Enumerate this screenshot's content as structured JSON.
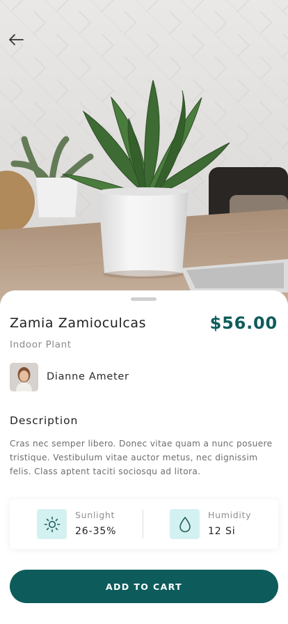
{
  "product": {
    "name": "Zamia Zamioculcas",
    "category": "Indoor Plant",
    "price": "$56.00"
  },
  "owner": {
    "name": "Dianne Ameter"
  },
  "description": {
    "heading": "Description",
    "text": "Cras nec semper libero. Donec vitae quam a nunc posuere tristique. Vestibulum vitae auctor metus, nec dignissim felis. Class aptent taciti sociosqu ad litora."
  },
  "stats": [
    {
      "label": "Sunlight",
      "value": "26-35%",
      "icon": "sun-icon"
    },
    {
      "label": "Humidity",
      "value": "12 Si",
      "icon": "water-drop-icon"
    }
  ],
  "actions": {
    "add_to_cart": "ADD TO CART"
  },
  "theme": {
    "accent": "#0d5c5b",
    "icon_bg": "#d3f1f0"
  }
}
